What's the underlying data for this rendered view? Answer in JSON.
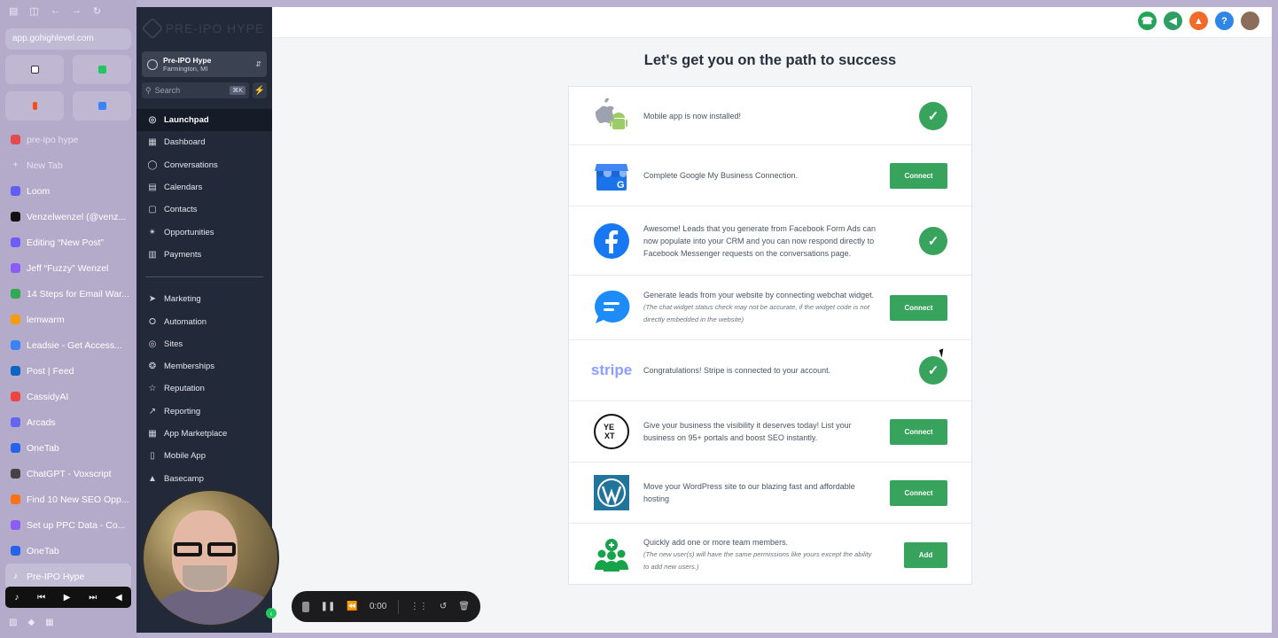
{
  "browser": {
    "url": "app.gohighlevel.com",
    "top_icons": [
      "▤",
      "◫",
      "←",
      "→",
      "↻"
    ],
    "tabs": [
      {
        "label": "pre-ipo hype",
        "color": "#e24c4c",
        "muted": true
      },
      {
        "label": "New Tab",
        "color": "transparent",
        "muted": true,
        "glyph": "+"
      },
      {
        "label": "Loom",
        "color": "#625df5"
      },
      {
        "label": "Venzelwenzel (@venz...",
        "color": "#111111"
      },
      {
        "label": "Editing “New Post”",
        "color": "#6d5dfc"
      },
      {
        "label": "Jeff “Fuzzy” Wenzel",
        "color": "#8b5cf6"
      },
      {
        "label": "14 Steps for Email War...",
        "color": "#34a853"
      },
      {
        "label": "lemwarm",
        "color": "#f59e0b"
      },
      {
        "label": "Leadsie - Get Access...",
        "color": "#3b82f6"
      },
      {
        "label": "Post | Feed",
        "color": "#0a66c2"
      },
      {
        "label": "CassidyAI",
        "color": "#ef4444"
      },
      {
        "label": "Arcads",
        "color": "#6366f1"
      },
      {
        "label": "OneTab",
        "color": "#2563eb"
      },
      {
        "label": "ChatGPT - Voxscript",
        "color": "#444444"
      },
      {
        "label": "Find 10 New SEO Opp...",
        "color": "#f97316"
      },
      {
        "label": "Set up PPC Data - Co...",
        "color": "#8b5cf6"
      },
      {
        "label": "OneTab",
        "color": "#2563eb"
      },
      {
        "label": "Pre-IPO Hype",
        "color": "transparent",
        "active": true,
        "glyph": "♪"
      }
    ],
    "media_controls": [
      "♪",
      "⏮",
      "▶",
      "⏭",
      "◀"
    ]
  },
  "app_nav": {
    "logo_text": "PRE-IPO HYPE",
    "account_name": "Pre-IPO Hype",
    "account_location": "Farmington, MI",
    "search_placeholder": "Search",
    "search_shortcut": "⌘K",
    "primary": [
      {
        "label": "Launchpad",
        "icon": "◎",
        "active": true
      },
      {
        "label": "Dashboard",
        "icon": "▦"
      },
      {
        "label": "Conversations",
        "icon": "◯"
      },
      {
        "label": "Calendars",
        "icon": "▤"
      },
      {
        "label": "Contacts",
        "icon": "▢"
      },
      {
        "label": "Opportunities",
        "icon": "✴"
      },
      {
        "label": "Payments",
        "icon": "▥"
      }
    ],
    "secondary": [
      {
        "label": "Marketing",
        "icon": "➤"
      },
      {
        "label": "Automation",
        "icon": "⭘"
      },
      {
        "label": "Sites",
        "icon": "◎"
      },
      {
        "label": "Memberships",
        "icon": "❂"
      },
      {
        "label": "Reputation",
        "icon": "☆"
      },
      {
        "label": "Reporting",
        "icon": "↗"
      },
      {
        "label": "App Marketplace",
        "icon": "▦"
      },
      {
        "label": "Mobile App",
        "icon": "▯"
      },
      {
        "label": "Basecamp",
        "icon": "▲"
      }
    ]
  },
  "topbar_icons": [
    {
      "name": "phone-icon",
      "glyph": "☎",
      "color": "#22a559"
    },
    {
      "name": "megaphone-icon",
      "glyph": "◀",
      "color": "#2f9e63",
      "dot": true
    },
    {
      "name": "bell-icon",
      "glyph": "▲",
      "color": "#f26b2a"
    },
    {
      "name": "help-icon",
      "glyph": "?",
      "color": "#2f86e6"
    },
    {
      "name": "avatar",
      "glyph": "",
      "color": "#8a6e5a"
    }
  ],
  "page": {
    "title": "Let's get you on the path to success",
    "steps": [
      {
        "name": "mobile-app",
        "text": "Mobile app is now installed!",
        "note": "",
        "status": "done",
        "logo": "mobile"
      },
      {
        "name": "google-my-business",
        "text": "Complete Google My Business Connection.",
        "note": "",
        "status": "action",
        "action_label": "Connect",
        "logo": "gmb"
      },
      {
        "name": "facebook-form-ads",
        "text": "Awesome! Leads that you generate from Facebook Form Ads can now populate into your CRM and you can now respond directly to Facebook Messenger requests on the conversations page.",
        "note": "",
        "status": "done",
        "logo": "facebook"
      },
      {
        "name": "webchat-widget",
        "text": "Generate leads from your website by connecting webchat widget.",
        "note": "(The chat widget status check may not be accurate, if the widget code is not directly embedded in the website)",
        "status": "action",
        "action_label": "Connect",
        "logo": "chat"
      },
      {
        "name": "stripe",
        "text": "Congratulations! Stripe is connected to your account.",
        "note": "",
        "status": "done",
        "logo": "stripe",
        "logo_text": "stripe"
      },
      {
        "name": "yext",
        "text": "Give your business the visibility it deserves today! List your business on 95+ portals and boost SEO instantly.",
        "note": "",
        "status": "action",
        "action_label": "Connect",
        "logo": "yext",
        "logo_text": "yext"
      },
      {
        "name": "wordpress",
        "text": "Move your WordPress site to our blazing fast and affordable hosting",
        "note": "",
        "status": "action",
        "action_label": "Connect",
        "logo": "wordpress"
      },
      {
        "name": "team-members",
        "text": "Quickly add one or more team members.",
        "note": "(The new user(s) will have the same permissions like yours except the ability to add new users.)",
        "status": "action",
        "action_label": "Add",
        "logo": "team"
      }
    ]
  },
  "recorder": {
    "time": "0:00"
  },
  "colors": {
    "accent_green": "#37a35c",
    "nav_bg": "#222a3a"
  }
}
